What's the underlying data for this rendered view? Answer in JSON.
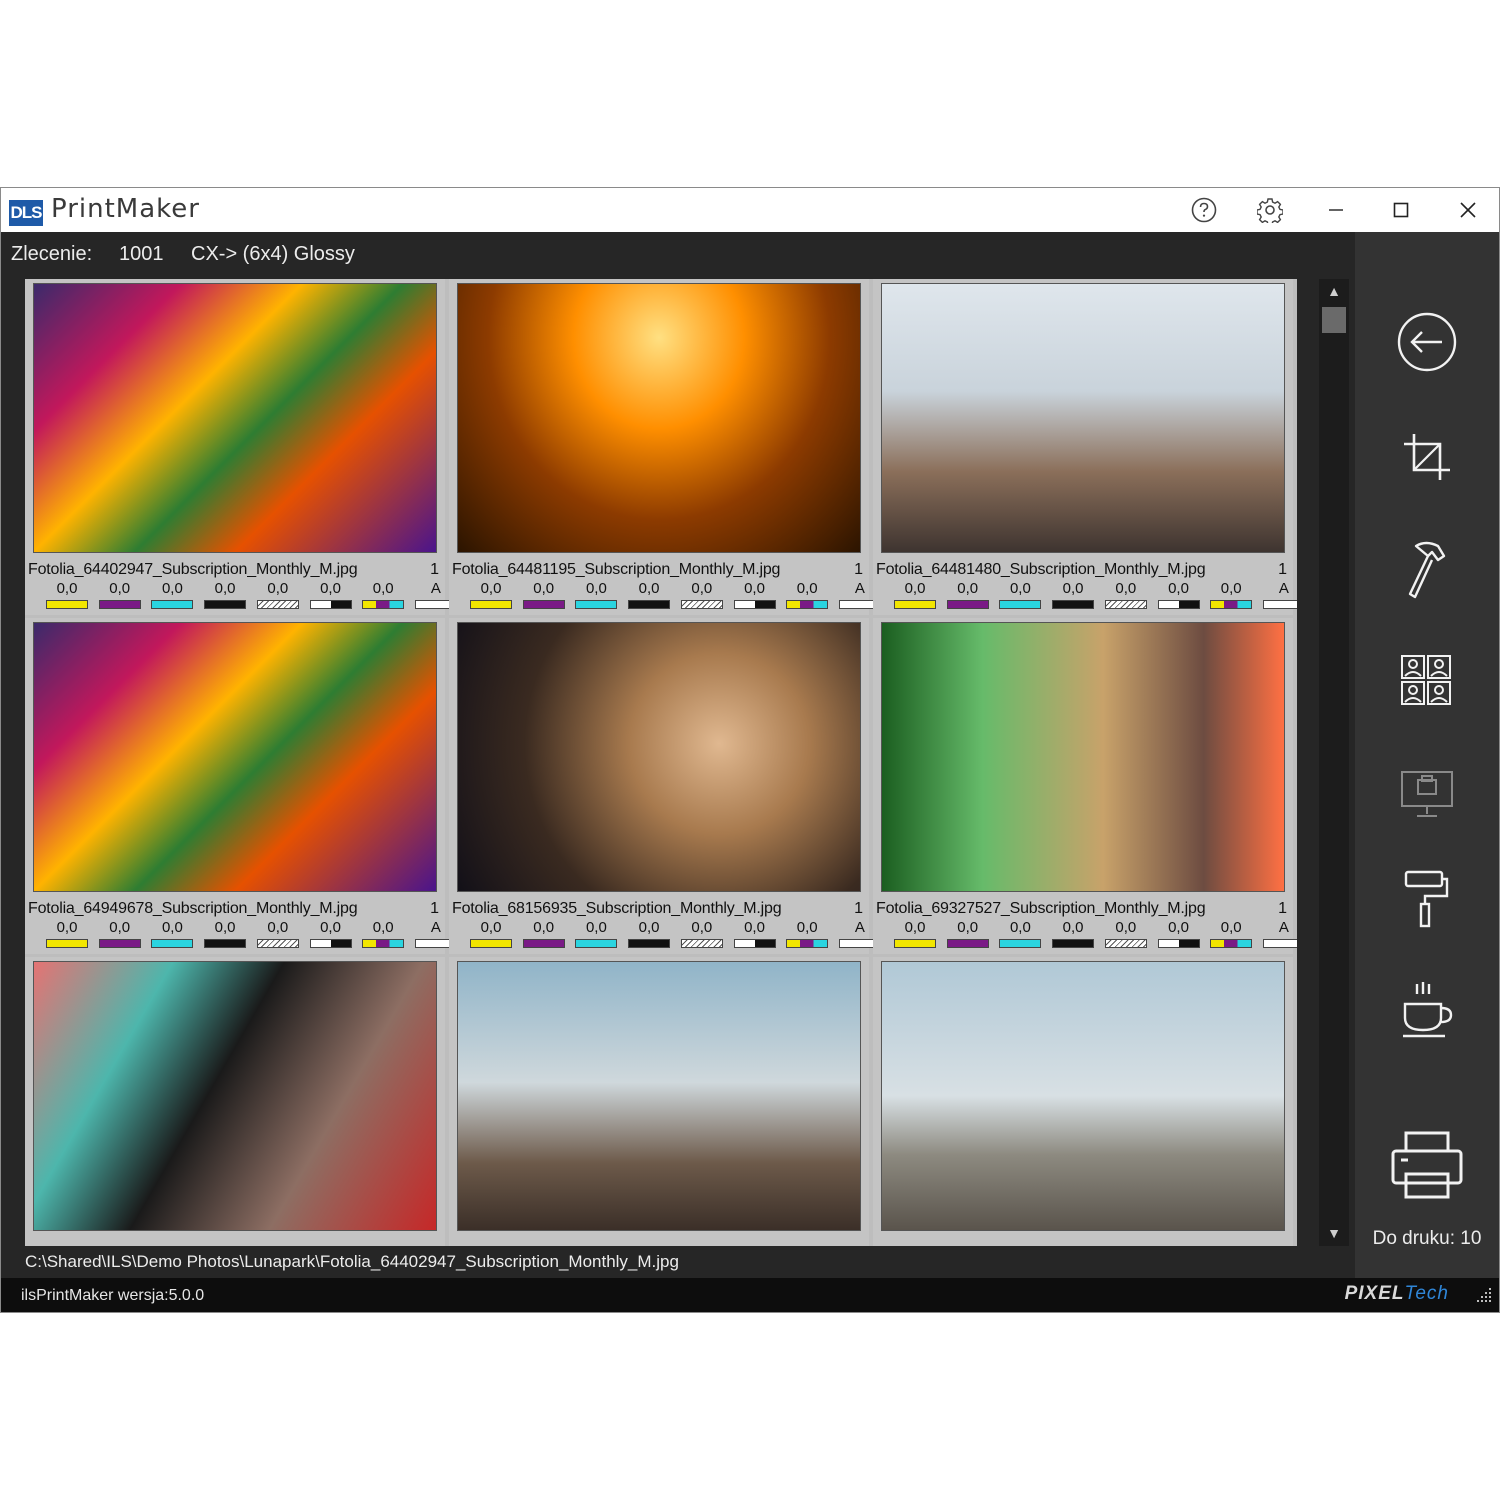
{
  "window": {
    "logo_text": "DLS",
    "app_title": "PrintMaker"
  },
  "toolbar": {
    "order_label": "Zlecenie:",
    "order_number": "1001",
    "print_format": "CX-> (6x4) Glossy"
  },
  "correction_channels": [
    {
      "name": "yellow",
      "color": "#f2e600"
    },
    {
      "name": "magenta",
      "color": "#7a1a86"
    },
    {
      "name": "cyan",
      "color": "#2ad4e0"
    },
    {
      "name": "black",
      "color": "#111111"
    },
    {
      "name": "density-hatch",
      "color": "#9a9a9a"
    },
    {
      "name": "contrast",
      "color": "#ffffff"
    },
    {
      "name": "saturation",
      "color": "#7a1a86"
    },
    {
      "name": "auto",
      "color": "#ffffff"
    }
  ],
  "photos": [
    {
      "filename": "Fotolia_64402947_Subscription_Monthly_M.jpg",
      "qty": "1",
      "values": [
        "0,0",
        "0,0",
        "0,0",
        "0,0",
        "0,0",
        "0,0",
        "0,0",
        "A"
      ],
      "scene": "funfair-night"
    },
    {
      "filename": "Fotolia_64481195_Subscription_Monthly_M.jpg",
      "qty": "1",
      "values": [
        "0,0",
        "0,0",
        "0,0",
        "0,0",
        "0,0",
        "0,0",
        "0,0",
        "A"
      ],
      "scene": "carousel-lights"
    },
    {
      "filename": "Fotolia_64481480_Subscription_Monthly_M.jpg",
      "qty": "1",
      "values": [
        "0,0",
        "0,0",
        "0,0",
        "0,0",
        "0,0",
        "0,0",
        "0,0",
        "A"
      ],
      "scene": "cotton-candy-day"
    },
    {
      "filename": "Fotolia_64949678_Subscription_Monthly_M.jpg",
      "qty": "1",
      "values": [
        "0,0",
        "0,0",
        "0,0",
        "0,0",
        "0,0",
        "0,0",
        "0,0",
        "A"
      ],
      "scene": "funfair-night"
    },
    {
      "filename": "Fotolia_68156935_Subscription_Monthly_M.jpg",
      "qty": "1",
      "values": [
        "0,0",
        "0,0",
        "0,0",
        "0,0",
        "0,0",
        "0,0",
        "0,0",
        "A"
      ],
      "scene": "bokeh-portrait"
    },
    {
      "filename": "Fotolia_69327527_Subscription_Monthly_M.jpg",
      "qty": "1",
      "values": [
        "0,0",
        "0,0",
        "0,0",
        "0,0",
        "0,0",
        "0,0",
        "0,0",
        "A"
      ],
      "scene": "green-lights"
    },
    {
      "filename": "",
      "qty": "",
      "values": [],
      "scene": "market-bag"
    },
    {
      "filename": "",
      "qty": "",
      "values": [],
      "scene": "ferris-selfie"
    },
    {
      "filename": "",
      "qty": "",
      "values": [],
      "scene": "ferris-group"
    }
  ],
  "path_text": "C:\\Shared\\ILS\\Demo Photos\\Lunapark\\Fotolia_64402947_Subscription_Monthly_M.jpg",
  "sidebar": {
    "buttons": [
      "back-icon",
      "crop-icon",
      "hammer-icon",
      "layout-icon",
      "monitor-print-icon",
      "paint-roller-icon",
      "coffee-icon",
      "printer-icon"
    ],
    "print_label": "Do druku: 10"
  },
  "status": {
    "version": "ilsPrintMaker wersja:5.0.0",
    "brand_part1": "PIXEL",
    "brand_part2": "Tech"
  },
  "colors": {
    "window_bg": "#262626",
    "sidebar_bg": "#333333",
    "grid_bg": "#bdbdbd",
    "accent": "#2f86d8"
  }
}
